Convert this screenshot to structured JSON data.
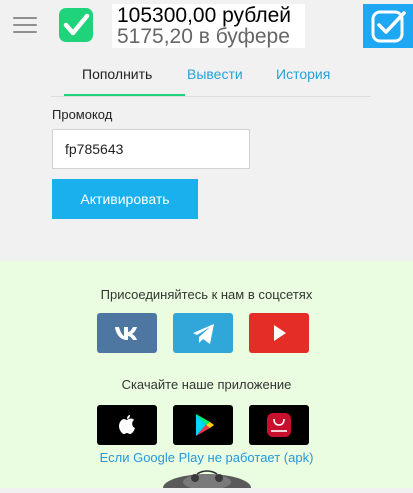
{
  "header": {
    "balance_main": "105300,00 рублей",
    "balance_buffer": "5175,20 в буфере"
  },
  "tabs": [
    {
      "label": "Пополнить",
      "active": true
    },
    {
      "label": "Вывести",
      "active": false
    },
    {
      "label": "История",
      "active": false
    }
  ],
  "promo": {
    "label": "Промокод",
    "value": "fp785643",
    "activate_label": "Активировать"
  },
  "footer": {
    "social_title": "Присоединяйтесь к нам в соцсетях",
    "social": [
      {
        "icon": "vk-icon",
        "color": "#4d76a1"
      },
      {
        "icon": "telegram-icon",
        "color": "#31a6d9"
      },
      {
        "icon": "youtube-icon",
        "color": "#e52d27"
      }
    ],
    "app_title": "Скачайте наше приложение",
    "apps": [
      {
        "icon": "apple-icon"
      },
      {
        "icon": "google-play-icon"
      },
      {
        "icon": "huawei-appgallery-icon"
      }
    ],
    "apk_link": "Если Google Play не работает (apk)"
  },
  "colors": {
    "accent_green": "#1fd37a",
    "accent_blue": "#1ab0ee",
    "footer_bg": "#eafde0"
  }
}
